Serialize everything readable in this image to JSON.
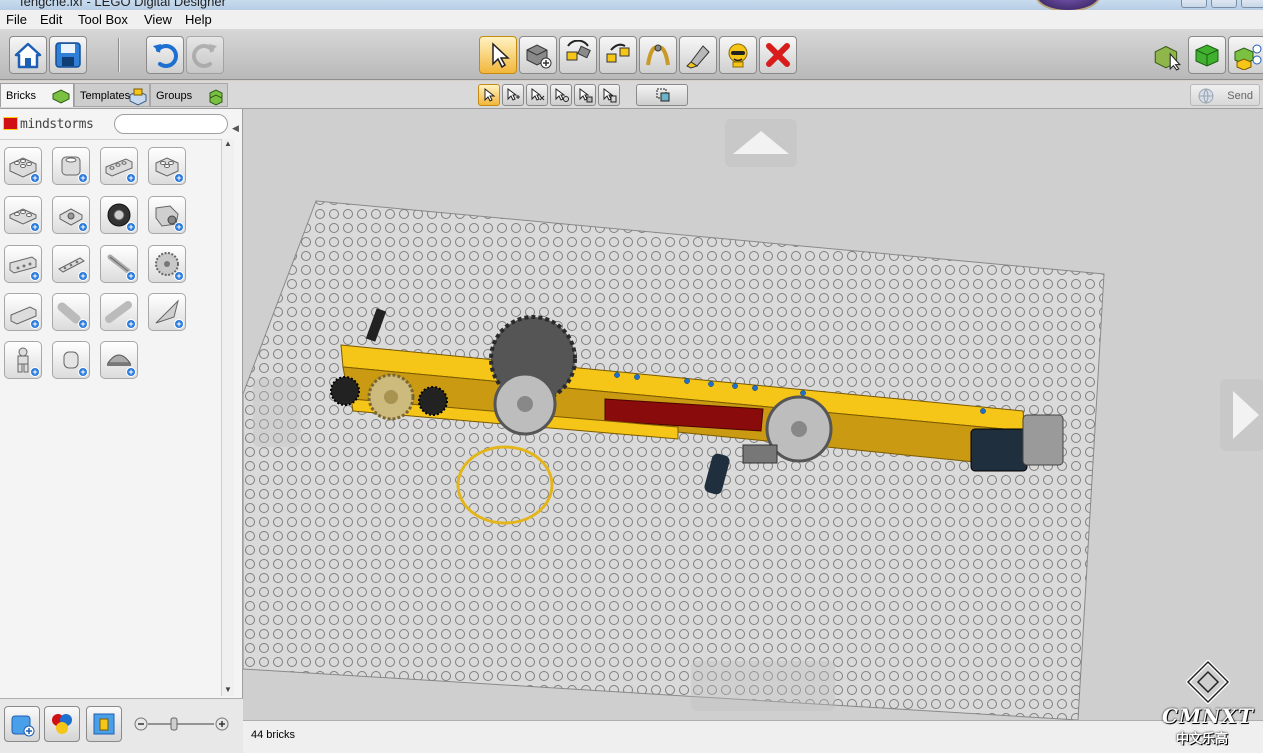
{
  "window": {
    "title": "fengche.lxf - LEGO Digital Designer"
  },
  "menu": {
    "items": [
      "File",
      "Edit",
      "Tool Box",
      "View",
      "Help"
    ]
  },
  "toolbar": {
    "buttons": [
      "home-icon",
      "save-icon",
      "undo-icon",
      "redo-icon",
      "select-arrow-icon",
      "clone-icon",
      "hinge-icon",
      "hinge-align-icon",
      "flex-icon",
      "paint-icon",
      "hide-icon",
      "delete-icon"
    ],
    "view_modes": [
      "build-mode-icon",
      "view-mode-icon",
      "building-guide-icon"
    ]
  },
  "tabs": {
    "bricks": "Bricks",
    "templates": "Templates",
    "groups": "Groups"
  },
  "send": {
    "label": "Send"
  },
  "palette": {
    "brand": "mindstorms",
    "search_placeholder": ""
  },
  "status": {
    "brick_count": "44 bricks"
  },
  "watermark": {
    "latin": "CMNXT",
    "chinese": "中文乐高"
  },
  "colors": {
    "accent_orange": "#f2b63a",
    "delete_red": "#d81c1c",
    "lego_yellow": "#f5c518",
    "lego_red": "#d01012",
    "baseplate": "#cfcfcf"
  }
}
